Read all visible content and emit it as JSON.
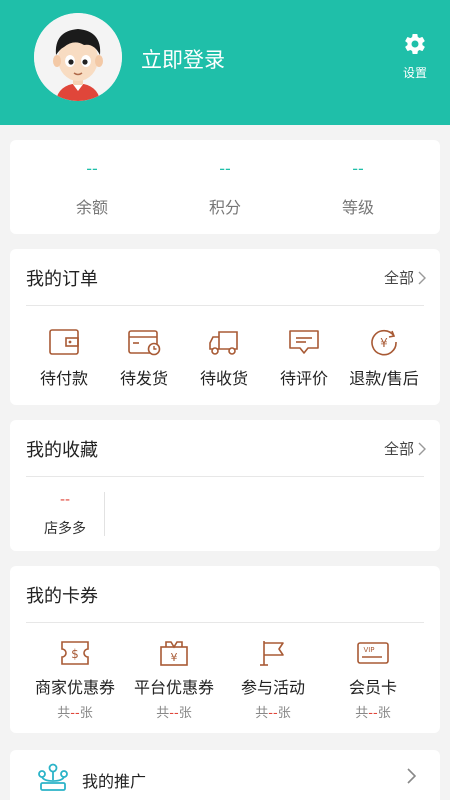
{
  "header": {
    "login_text": "立即登录",
    "settings_label": "设置",
    "bg_color": "#1fbfa9"
  },
  "stats": [
    {
      "value": "--",
      "label": "余额"
    },
    {
      "value": "--",
      "label": "积分"
    },
    {
      "value": "--",
      "label": "等级"
    }
  ],
  "orders": {
    "title": "我的订单",
    "more": "全部",
    "items": [
      {
        "label": "待付款",
        "icon": "wallet-icon"
      },
      {
        "label": "待发货",
        "icon": "card-clock-icon"
      },
      {
        "label": "待收货",
        "icon": "truck-icon"
      },
      {
        "label": "待评价",
        "icon": "comment-icon"
      },
      {
        "label": "退款/售后",
        "icon": "refund-icon"
      }
    ]
  },
  "favorites": {
    "title": "我的收藏",
    "more": "全部",
    "shop_count": "--",
    "shop_label": "店多多"
  },
  "cards": {
    "title": "我的卡券",
    "items": [
      {
        "label": "商家优惠券",
        "count_prefix": "共",
        "count": "--",
        "count_suffix": "张",
        "icon": "dollar-ticket-icon"
      },
      {
        "label": "平台优惠券",
        "count_prefix": "共",
        "count": "--",
        "count_suffix": "张",
        "icon": "yuan-box-icon"
      },
      {
        "label": "参与活动",
        "count_prefix": "共",
        "count": "--",
        "count_suffix": "张",
        "icon": "flag-icon"
      },
      {
        "label": "会员卡",
        "count_prefix": "共",
        "count": "--",
        "count_suffix": "张",
        "icon": "vip-card-icon"
      }
    ]
  },
  "promotion": {
    "label": "我的推广",
    "icon": "network-icon"
  },
  "colors": {
    "accent": "#1fbfa9",
    "icon_stroke": "#a85a35",
    "count_red": "#e0463a"
  }
}
